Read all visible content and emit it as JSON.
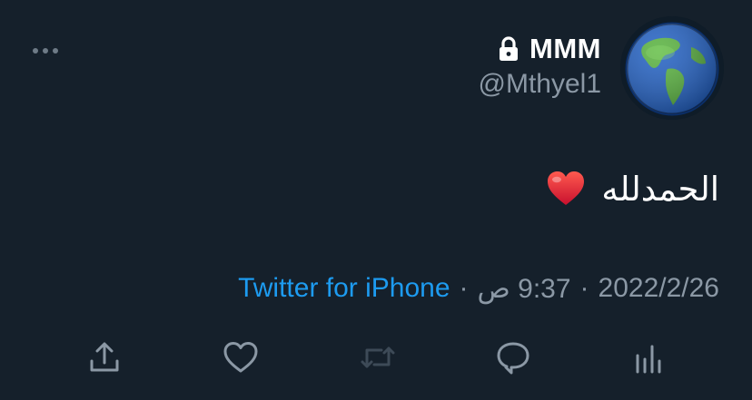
{
  "tweet": {
    "display_name": "MMM",
    "handle": "@Mthyel1",
    "protected_icon": "lock-icon",
    "text": "الحمدلله",
    "emoji": "red-heart-emoji",
    "date": "2022/2/26",
    "time": "9:37 ص",
    "separator": "·",
    "source": "Twitter for iPhone"
  },
  "colors": {
    "background": "#15202b",
    "text_primary": "#ffffff",
    "text_secondary": "#8b98a5",
    "link": "#1d9bf0"
  },
  "actions": [
    "share-icon",
    "like-icon",
    "retweet-icon",
    "reply-icon",
    "analytics-icon"
  ]
}
